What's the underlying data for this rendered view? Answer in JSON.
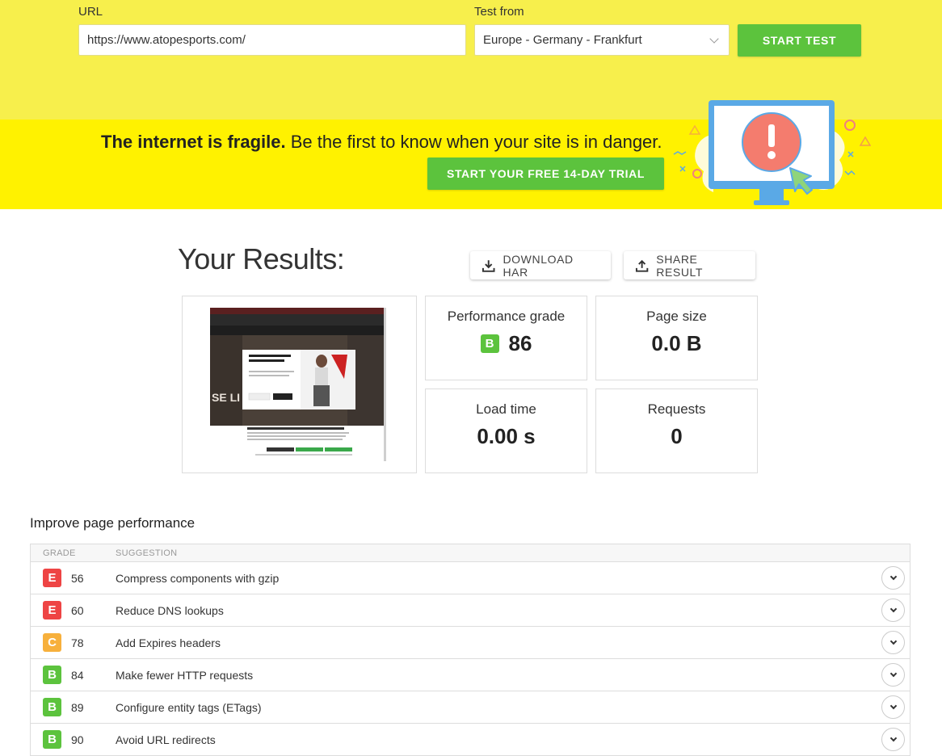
{
  "form": {
    "url_label": "URL",
    "url_value": "https://www.atopesports.com/",
    "test_from_label": "Test from",
    "test_from_value": "Europe - Germany - Frankfurt",
    "start_button": "START TEST"
  },
  "promo": {
    "headline_bold": "The internet is fragile.",
    "headline_rest": " Be the first to know when your site is in danger.",
    "cta": "START YOUR FREE 14-DAY TRIAL"
  },
  "results": {
    "title": "Your Results:",
    "download_har": "DOWNLOAD HAR",
    "share_result": "SHARE RESULT",
    "performance_label": "Performance grade",
    "performance_grade": "B",
    "performance_score": "86",
    "page_size_label": "Page size",
    "page_size_value": "0.0 B",
    "load_time_label": "Load time",
    "load_time_value": "0.00 s",
    "requests_label": "Requests",
    "requests_value": "0"
  },
  "improve": {
    "title": "Improve page performance",
    "col_grade": "GRADE",
    "col_suggestion": "SUGGESTION",
    "rows": [
      {
        "grade": "E",
        "score": "56",
        "suggestion": "Compress components with gzip",
        "color": "#ee4444"
      },
      {
        "grade": "E",
        "score": "60",
        "suggestion": "Reduce DNS lookups",
        "color": "#ee4444"
      },
      {
        "grade": "C",
        "score": "78",
        "suggestion": "Add Expires headers",
        "color": "#f7b03c"
      },
      {
        "grade": "B",
        "score": "84",
        "suggestion": "Make fewer HTTP requests",
        "color": "#5cc33d"
      },
      {
        "grade": "B",
        "score": "89",
        "suggestion": "Configure entity tags (ETags)",
        "color": "#5cc33d"
      },
      {
        "grade": "B",
        "score": "90",
        "suggestion": "Avoid URL redirects",
        "color": "#5cc33d"
      }
    ]
  },
  "colors": {
    "top_band": "#f7ef4c",
    "promo_band": "#fff200",
    "accent_green": "#5cc33d"
  }
}
